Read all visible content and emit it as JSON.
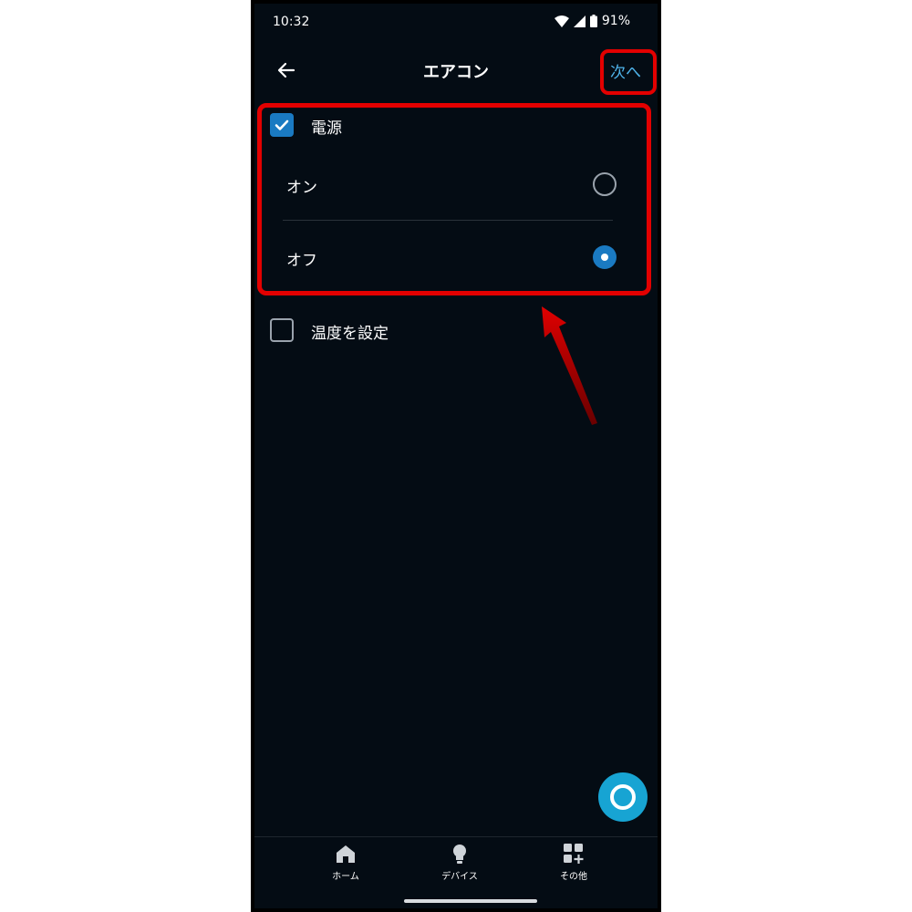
{
  "status_bar": {
    "time": "10:32",
    "battery": "91%"
  },
  "header": {
    "title": "エアコン",
    "next_label": "次へ"
  },
  "power_section": {
    "label": "電源",
    "checked": true,
    "options": [
      {
        "label": "オン",
        "selected": false
      },
      {
        "label": "オフ",
        "selected": true
      }
    ]
  },
  "temperature_section": {
    "label": "温度を設定",
    "checked": false
  },
  "bottom_nav": [
    {
      "label": "ホーム",
      "icon": "home-icon"
    },
    {
      "label": "デバイス",
      "icon": "bulb-icon"
    },
    {
      "label": "その他",
      "icon": "more-icon"
    }
  ],
  "colors": {
    "background": "#040c14",
    "accent": "#1a7ac2",
    "link": "#4fb3ea",
    "highlight": "#e30000",
    "alexa": "#17a4d3"
  }
}
